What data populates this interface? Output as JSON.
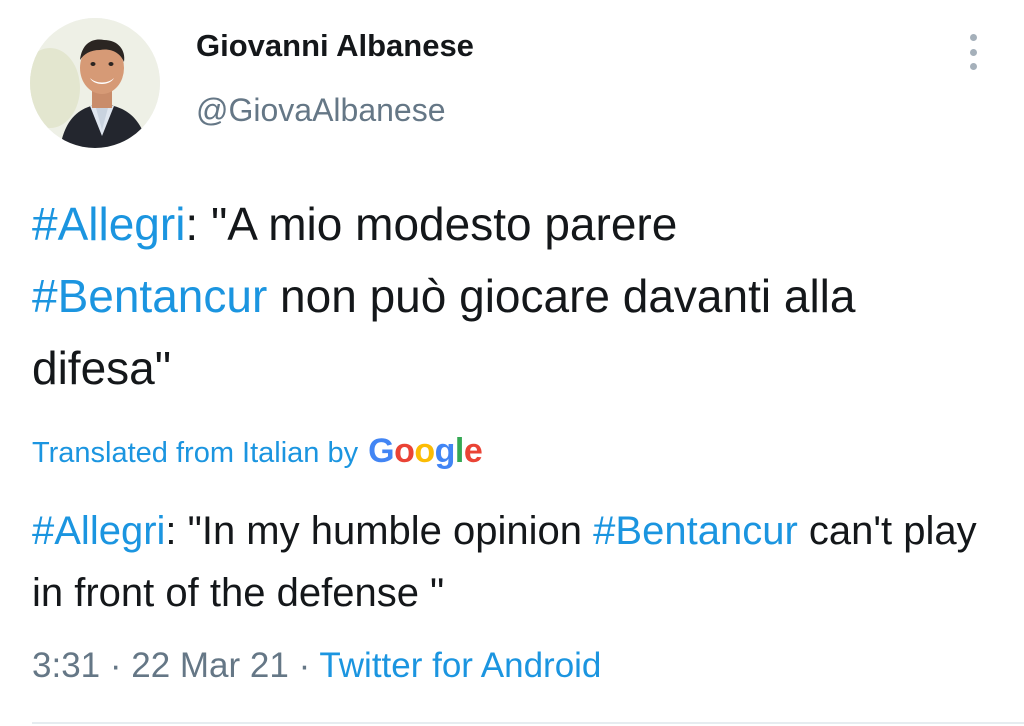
{
  "user": {
    "display_name": "Giovanni Albanese",
    "handle": "@GiovaAlbanese"
  },
  "icons": {
    "more": "more-vertical-icon",
    "google": "google-logo"
  },
  "tweet": {
    "segments": [
      {
        "text": "#Allegri",
        "hashtag": true
      },
      {
        "text": ": \"A mio modesto parere ",
        "hashtag": false
      },
      {
        "text": "#Bentancur",
        "hashtag": true
      },
      {
        "text": " non può giocare davanti alla difesa\"",
        "hashtag": false
      }
    ]
  },
  "translation": {
    "label": "Translated from Italian by",
    "provider_letters": [
      "G",
      "o",
      "o",
      "g",
      "l",
      "e"
    ],
    "segments": [
      {
        "text": "#Allegri",
        "hashtag": true
      },
      {
        "text": ": \"In my humble opinion ",
        "hashtag": false
      },
      {
        "text": "#Bentancur",
        "hashtag": true
      },
      {
        "text": " can't play in front of the defense \"",
        "hashtag": false
      }
    ]
  },
  "meta": {
    "time": "3:31",
    "separator": "·",
    "date": "22 Mar 21",
    "source": "Twitter for Android"
  },
  "colors": {
    "text": "#14171a",
    "secondary": "#657786",
    "link": "#1b95e0",
    "google_blue": "#4285f4",
    "google_red": "#ea4335",
    "google_yellow": "#fbbc05",
    "google_green": "#34a853"
  }
}
